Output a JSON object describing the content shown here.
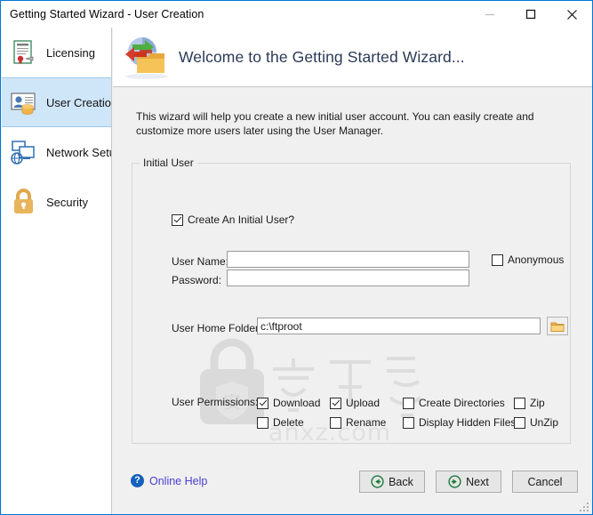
{
  "window": {
    "title": "Getting Started Wizard - User Creation",
    "controls": {
      "minimize": "minimize-icon",
      "maximize": "maximize-icon",
      "close": "close-icon"
    }
  },
  "sidebar": {
    "items": [
      {
        "label": "Licensing",
        "icon": "certificate-icon",
        "selected": false
      },
      {
        "label": "User Creation",
        "icon": "user-card-icon",
        "selected": true
      },
      {
        "label": "Network Setup",
        "icon": "network-icon",
        "selected": false
      },
      {
        "label": "Security",
        "icon": "lock-icon",
        "selected": false
      }
    ]
  },
  "banner": {
    "title": "Welcome to the Getting Started Wizard...",
    "icon": "globe-folder-icon"
  },
  "main": {
    "description": "This wizard will help you create a new initial user account.  You can easily create and customize more users later using the User Manager.",
    "group": {
      "legend": "Initial User",
      "create_user": {
        "label": "Create An Initial User?",
        "checked": true
      },
      "fields": {
        "username": {
          "label": "User Name:",
          "value": "",
          "placeholder": ""
        },
        "password": {
          "label": "Password:",
          "value": "",
          "placeholder": ""
        },
        "home_folder": {
          "label": "User Home Folder:",
          "value": "c:\\ftproot",
          "placeholder": ""
        }
      },
      "anonymous": {
        "label": "Anonymous",
        "checked": false
      },
      "browse_button": "folder-icon",
      "permissions": {
        "label": "User Permissions:",
        "rows": [
          [
            {
              "label": "Download",
              "checked": true
            },
            {
              "label": "Upload",
              "checked": true
            },
            {
              "label": "Create Directories",
              "checked": false
            },
            {
              "label": "Zip",
              "checked": false
            }
          ],
          [
            {
              "label": "Delete",
              "checked": false
            },
            {
              "label": "Rename",
              "checked": false
            },
            {
              "label": "Display Hidden Files",
              "checked": false
            },
            {
              "label": "UnZip",
              "checked": false
            }
          ]
        ]
      }
    }
  },
  "footer": {
    "help": {
      "label": "Online Help",
      "icon": "question-mark-icon"
    },
    "buttons": [
      {
        "label": "Back",
        "icon": "arrow-left-circle-icon"
      },
      {
        "label": "Next",
        "icon": "arrow-right-circle-icon"
      },
      {
        "label": "Cancel",
        "icon": ""
      }
    ]
  },
  "watermark": {
    "text_cn": "安下载",
    "text_domain": "anxz.com"
  },
  "colors": {
    "accent": "#0078d7",
    "selection": "#cfe6f9",
    "banner_title": "#2b3a55",
    "link": "#4a3fd1",
    "button_arrow": "#1a7a3c"
  }
}
